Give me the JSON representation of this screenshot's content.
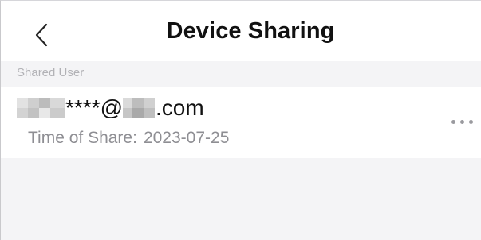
{
  "header": {
    "back_icon": "chevron-left-icon",
    "title": "Device Sharing"
  },
  "section": {
    "label": "Shared User"
  },
  "shared_users": [
    {
      "email_masked_middle": "****@",
      "email_domain_suffix": ".com",
      "time_label": "Time of Share:",
      "time_value": "2023-07-25",
      "more_icon": "more-horizontal-icon"
    }
  ],
  "colors": {
    "header_bg": "#ffffff",
    "page_bg": "#f4f4f6",
    "title": "#111111",
    "muted_text": "#8e8e93",
    "section_label": "#b2b2b6"
  }
}
